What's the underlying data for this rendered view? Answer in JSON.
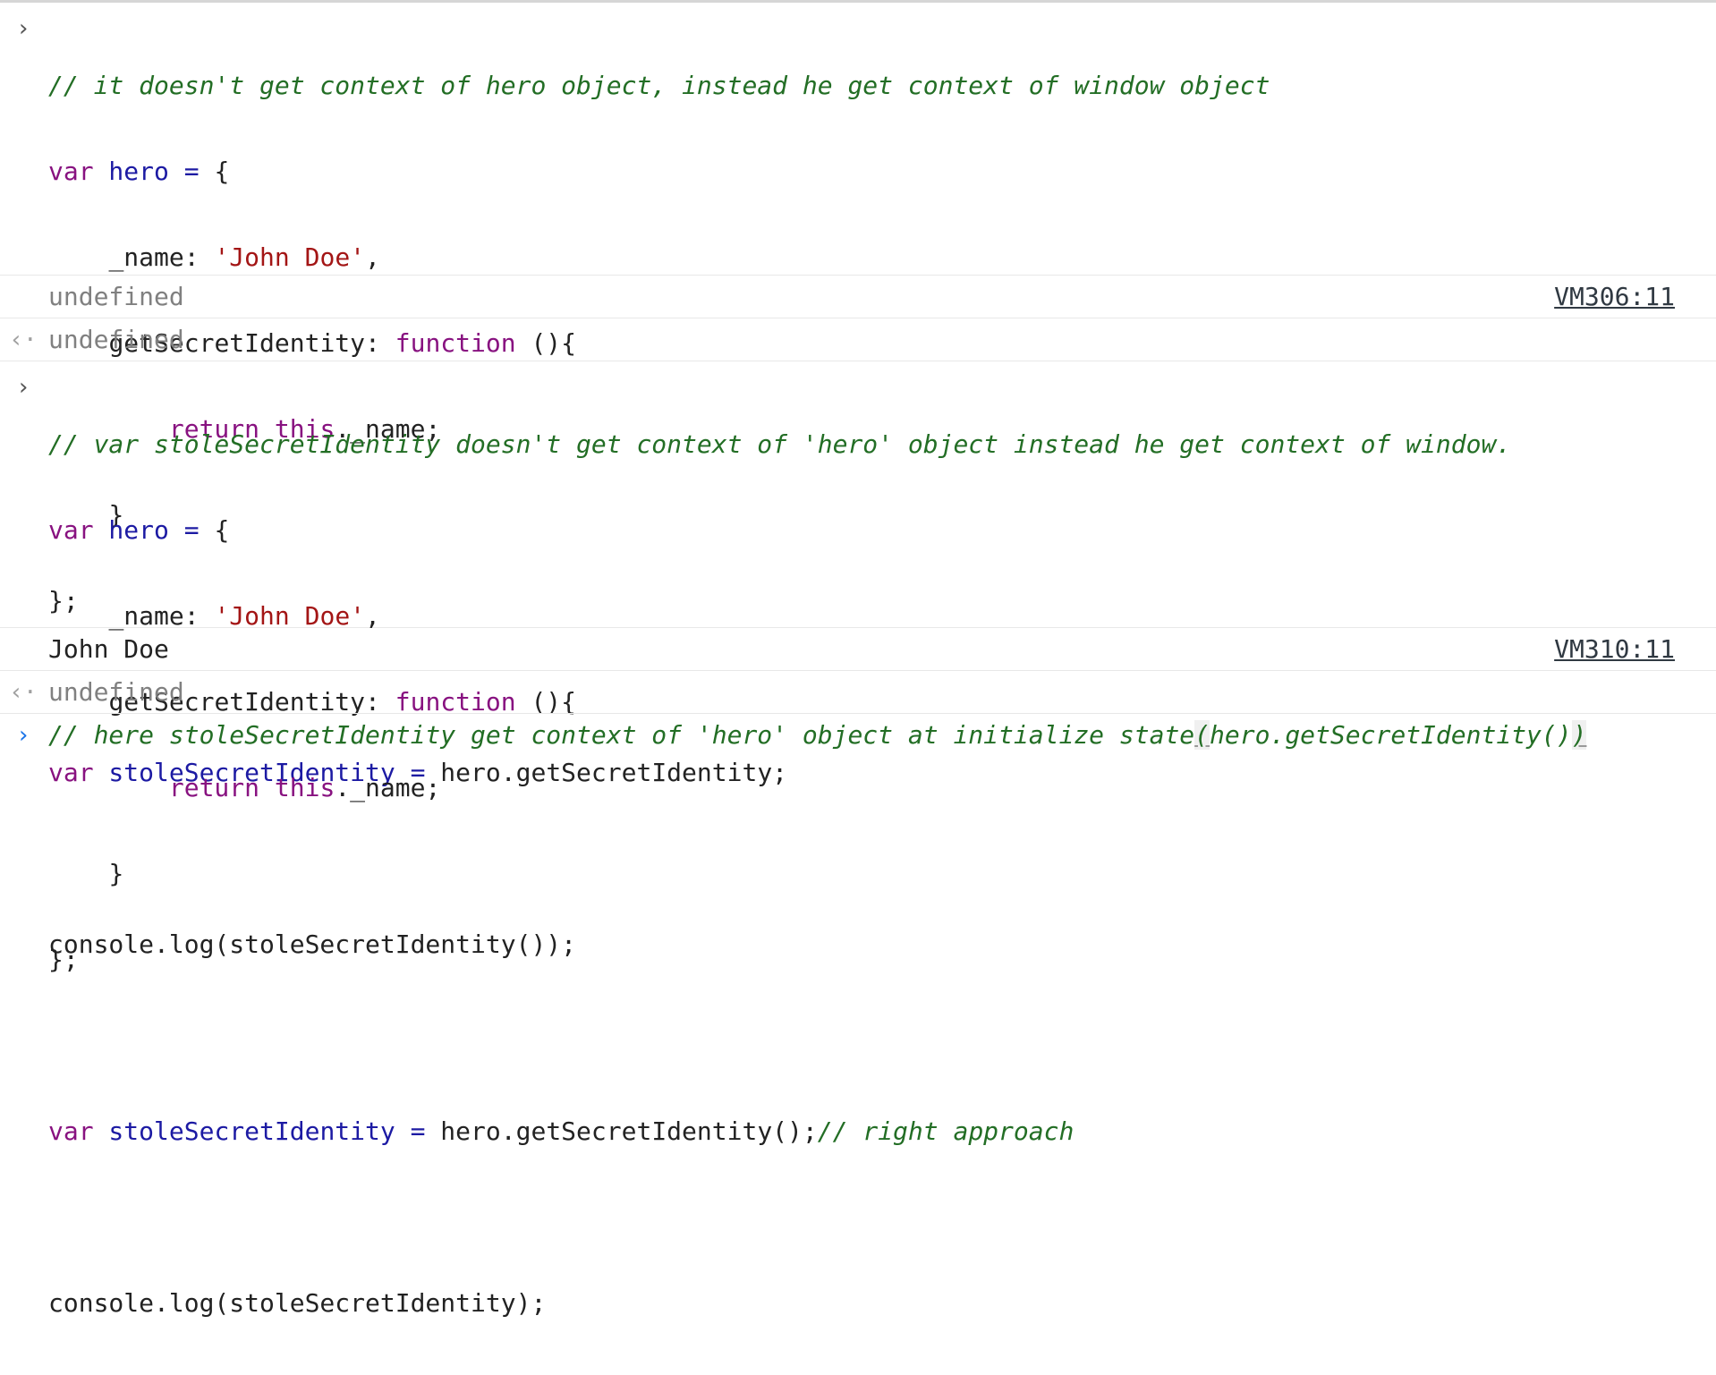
{
  "entries": [
    {
      "kind": "input",
      "lines": [
        {
          "comment": "// it doesn't get context of hero object, instead he get context of window object"
        },
        {
          "kw": "var",
          "name": " hero",
          "op": " =",
          "rest": " {"
        },
        {
          "indent": "    ",
          "prop": "_name: ",
          "str": "'John Doe'",
          "rest": ","
        },
        {
          "indent": "    ",
          "prop": "getSecretIdentity: ",
          "kw": "function",
          "rest": " (){"
        },
        {
          "indent": "        ",
          "kw": "return",
          "kw2": " this",
          "rest": "._name;"
        },
        {
          "indent": "    ",
          "rest": "}"
        },
        {
          "rest": "};"
        },
        {
          "rest": ""
        },
        {
          "kw": "var",
          "name": " stoleSecretIdentity",
          "op": " =",
          "rest": " hero.getSecretIdentity;"
        },
        {
          "rest": ""
        },
        {
          "rest": "console.log(stoleSecretIdentity());"
        }
      ]
    },
    {
      "kind": "log",
      "text": "undefined",
      "source": "VM306:11"
    },
    {
      "kind": "result",
      "text": "undefined"
    },
    {
      "kind": "input",
      "lines": [
        {
          "comment": "// var stoleSecretIdentity doesn't get context of 'hero' object instead he get context of window."
        },
        {
          "kw": "var",
          "name": " hero",
          "op": " =",
          "rest": " {"
        },
        {
          "indent": "    ",
          "prop": "_name: ",
          "str": "'John Doe'",
          "rest": ","
        },
        {
          "indent": "    ",
          "prop": "getSecretIdentity: ",
          "kw": "function",
          "rest": " (){"
        },
        {
          "indent": "        ",
          "kw": "return",
          "kw2": " this",
          "rest": "._name;"
        },
        {
          "indent": "    ",
          "rest": "}"
        },
        {
          "rest": "};"
        },
        {
          "rest": ""
        },
        {
          "kw": "var",
          "name": " stoleSecretIdentity",
          "op": " =",
          "rest": " hero.getSecretIdentity();",
          "comment": "// right approach"
        },
        {
          "rest": ""
        },
        {
          "rest": "console.log(stoleSecretIdentity);"
        }
      ]
    },
    {
      "kind": "log",
      "text": "John Doe",
      "source": "VM310:11"
    },
    {
      "kind": "result",
      "text": "undefined"
    }
  ],
  "prompt": {
    "comment_pre": "// here stoleSecretIdentity get context of 'hero' object at initialize state",
    "bracket_open": "(",
    "comment_mid": "hero.getSecretIdentity()",
    "bracket_close": ")"
  },
  "colors": {
    "comment": "#236e25",
    "keyword": "#881280",
    "variable": "#1c1aa3",
    "string": "#a31515",
    "prompt_active": "#1a73e8"
  },
  "icons": {
    "input_prompt": "chevron-right-icon",
    "result_arrow": "result-arrow-icon"
  }
}
